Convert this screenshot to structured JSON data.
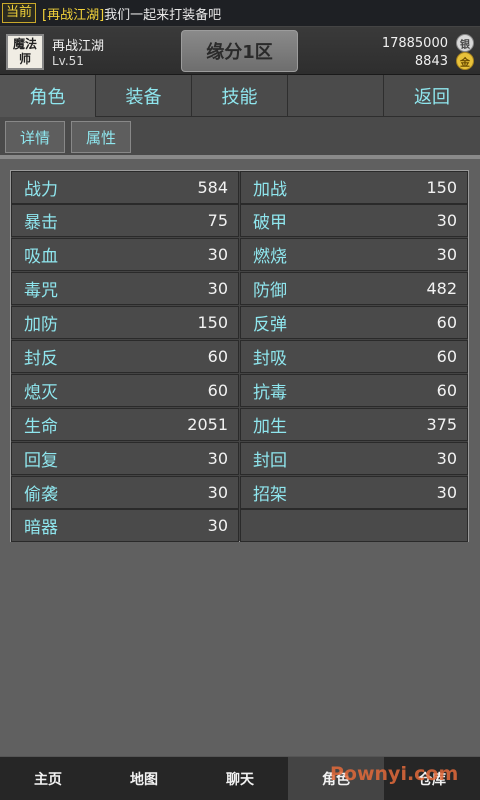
{
  "ticker": {
    "channel": "当前",
    "speaker": "[再战江湖]",
    "message": "我们一起来打装备吧"
  },
  "player": {
    "avatar_text": "魔法师",
    "name": "再战江湖",
    "level": "Lv.51",
    "server": "缘分1区",
    "silver": "17885000",
    "silver_icon": "银",
    "gold": "8843",
    "gold_icon": "金"
  },
  "main_tabs": [
    {
      "label": "角色"
    },
    {
      "label": "装备"
    },
    {
      "label": "技能"
    },
    {
      "label": ""
    },
    {
      "label": "返回"
    }
  ],
  "sub_tabs": [
    {
      "label": "详情"
    },
    {
      "label": "属性"
    }
  ],
  "attributes": [
    [
      {
        "label": "战力",
        "value": "584"
      },
      {
        "label": "加战",
        "value": "150"
      }
    ],
    [
      {
        "label": "暴击",
        "value": "75"
      },
      {
        "label": "破甲",
        "value": "30"
      }
    ],
    [
      {
        "label": "吸血",
        "value": "30"
      },
      {
        "label": "燃烧",
        "value": "30"
      }
    ],
    [
      {
        "label": "毒咒",
        "value": "30"
      },
      {
        "label": "防御",
        "value": "482"
      }
    ],
    [
      {
        "label": "加防",
        "value": "150"
      },
      {
        "label": "反弹",
        "value": "60"
      }
    ],
    [
      {
        "label": "封反",
        "value": "60"
      },
      {
        "label": "封吸",
        "value": "60"
      }
    ],
    [
      {
        "label": "熄灭",
        "value": "60"
      },
      {
        "label": "抗毒",
        "value": "60"
      }
    ],
    [
      {
        "label": "生命",
        "value": "2051"
      },
      {
        "label": "加生",
        "value": "375"
      }
    ],
    [
      {
        "label": "回复",
        "value": "30"
      },
      {
        "label": "封回",
        "value": "30"
      }
    ],
    [
      {
        "label": "偷袭",
        "value": "30"
      },
      {
        "label": "招架",
        "value": "30"
      }
    ],
    [
      {
        "label": "暗器",
        "value": "30"
      },
      {
        "label": "",
        "value": ""
      }
    ]
  ],
  "bottom_nav": [
    {
      "label": "主页"
    },
    {
      "label": "地图"
    },
    {
      "label": "聊天"
    },
    {
      "label": "角色"
    },
    {
      "label": "仓库"
    }
  ],
  "watermark": "Pownyi.com",
  "colors": {
    "accent_text": "#8fe6ee",
    "ticker_highlight": "#f2d23a",
    "background": "#606060"
  }
}
